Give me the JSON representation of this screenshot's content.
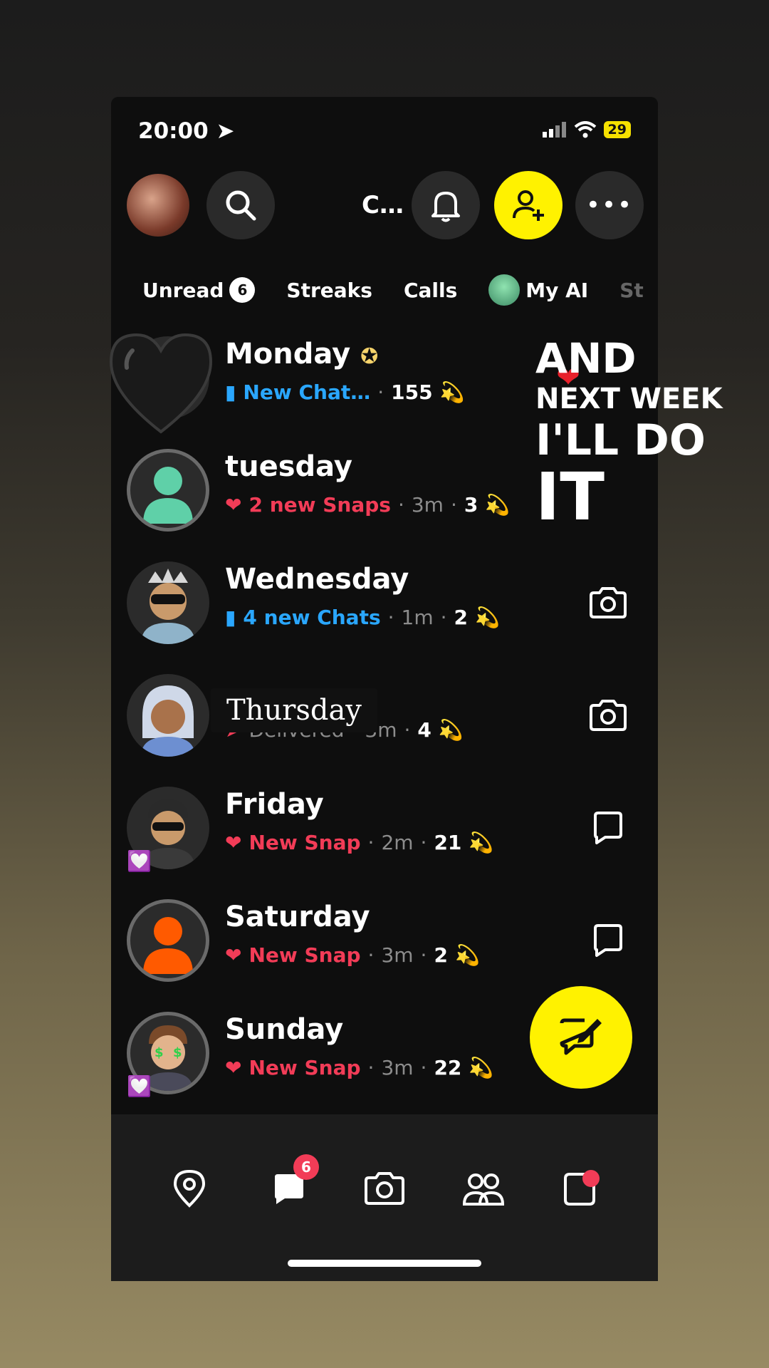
{
  "status": {
    "time": "20:00",
    "battery": "29"
  },
  "header": {
    "title": "C…"
  },
  "filters": [
    {
      "label": "Unread",
      "count": "6"
    },
    {
      "label": "Streaks"
    },
    {
      "label": "Calls"
    },
    {
      "label": "My AI"
    },
    {
      "label": "St"
    }
  ],
  "chats": [
    {
      "name": "Monday",
      "status": "New Chat…",
      "status_kind": "chat",
      "streak": "155"
    },
    {
      "name": "tuesday",
      "status": "2 new Snaps",
      "status_kind": "snap",
      "time": "3m",
      "streak": "3"
    },
    {
      "name": "Wednesday",
      "status": "4 new Chats",
      "status_kind": "chat",
      "time": "1m",
      "streak": "2"
    },
    {
      "name": "Thursday",
      "status": "Delivered",
      "status_kind": "delivered",
      "time": "3m",
      "streak": "4"
    },
    {
      "name": "Friday",
      "status": "New Snap",
      "status_kind": "snap",
      "time": "2m",
      "streak": "21"
    },
    {
      "name": "Saturday",
      "status": "New Snap",
      "status_kind": "snap",
      "time": "3m",
      "streak": "2"
    },
    {
      "name": "Sunday",
      "status": "New Snap",
      "status_kind": "snap",
      "time": "3m",
      "streak": "22"
    }
  ],
  "overlay": {
    "line1": "AND",
    "line2": "NEXT WEEK",
    "line3": "I'LL DO",
    "line4": "IT"
  },
  "nav": {
    "chat_badge": "6"
  },
  "colors": {
    "snap_yellow": "#fff200",
    "chat_blue": "#2aa7ff",
    "snap_red": "#f23c57"
  }
}
